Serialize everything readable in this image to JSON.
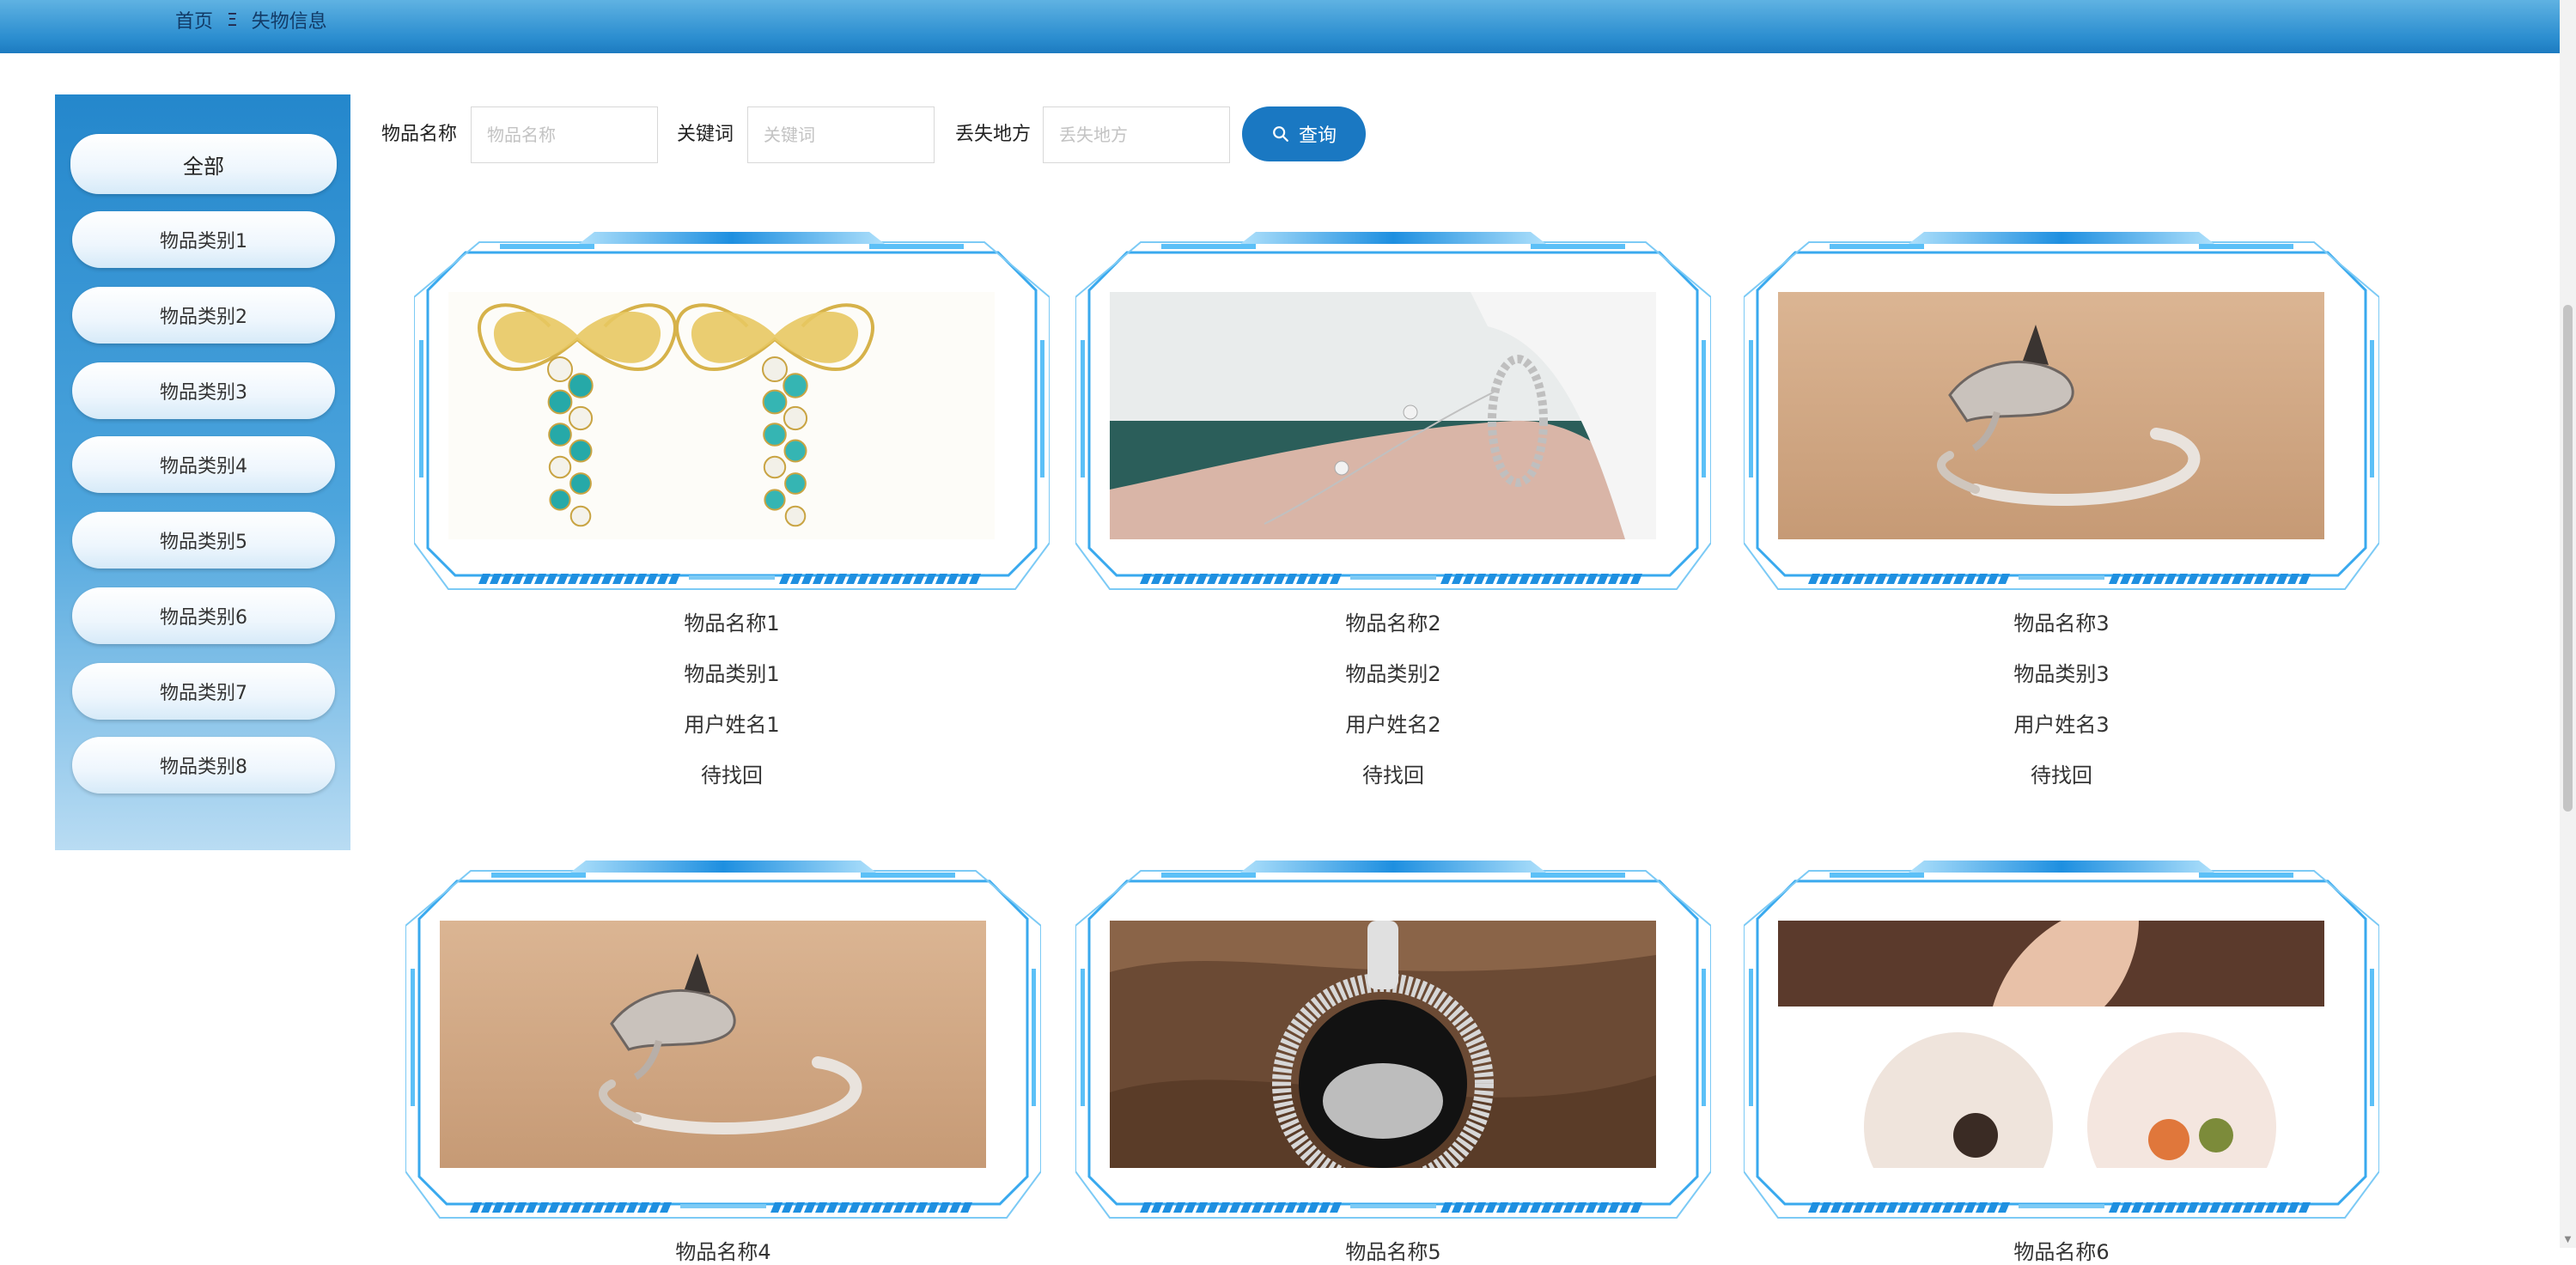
{
  "breadcrumb": {
    "home": "首页",
    "separator": "Ξ",
    "current": "失物信息"
  },
  "sidebar": {
    "categories": [
      "全部",
      "物品类别1",
      "物品类别2",
      "物品类别3",
      "物品类别4",
      "物品类别5",
      "物品类别6",
      "物品类别7",
      "物品类别8"
    ]
  },
  "search": {
    "name_label": "物品名称",
    "name_placeholder": "物品名称",
    "keyword_label": "关键词",
    "keyword_placeholder": "关键词",
    "place_label": "丢失地方",
    "place_placeholder": "丢失地方",
    "query_label": "查询"
  },
  "items": [
    {
      "name": "物品名称1",
      "category": "物品类别1",
      "user": "用户姓名1",
      "status": "待找回",
      "photo": "earrings"
    },
    {
      "name": "物品名称2",
      "category": "物品类别2",
      "user": "用户姓名2",
      "status": "待找回",
      "photo": "bracelet"
    },
    {
      "name": "物品名称3",
      "category": "物品类别3",
      "user": "用户姓名3",
      "status": "待找回",
      "photo": "ring"
    },
    {
      "name": "物品名称4",
      "photo": "ring"
    },
    {
      "name": "物品名称5",
      "photo": "pendant"
    },
    {
      "name": "物品名称6",
      "photo": "studs"
    }
  ],
  "colors": {
    "topbar": "#2c8ed0",
    "accent": "#1a78c2",
    "frame": "#39a9ee",
    "sidebar": "#2487cc"
  }
}
